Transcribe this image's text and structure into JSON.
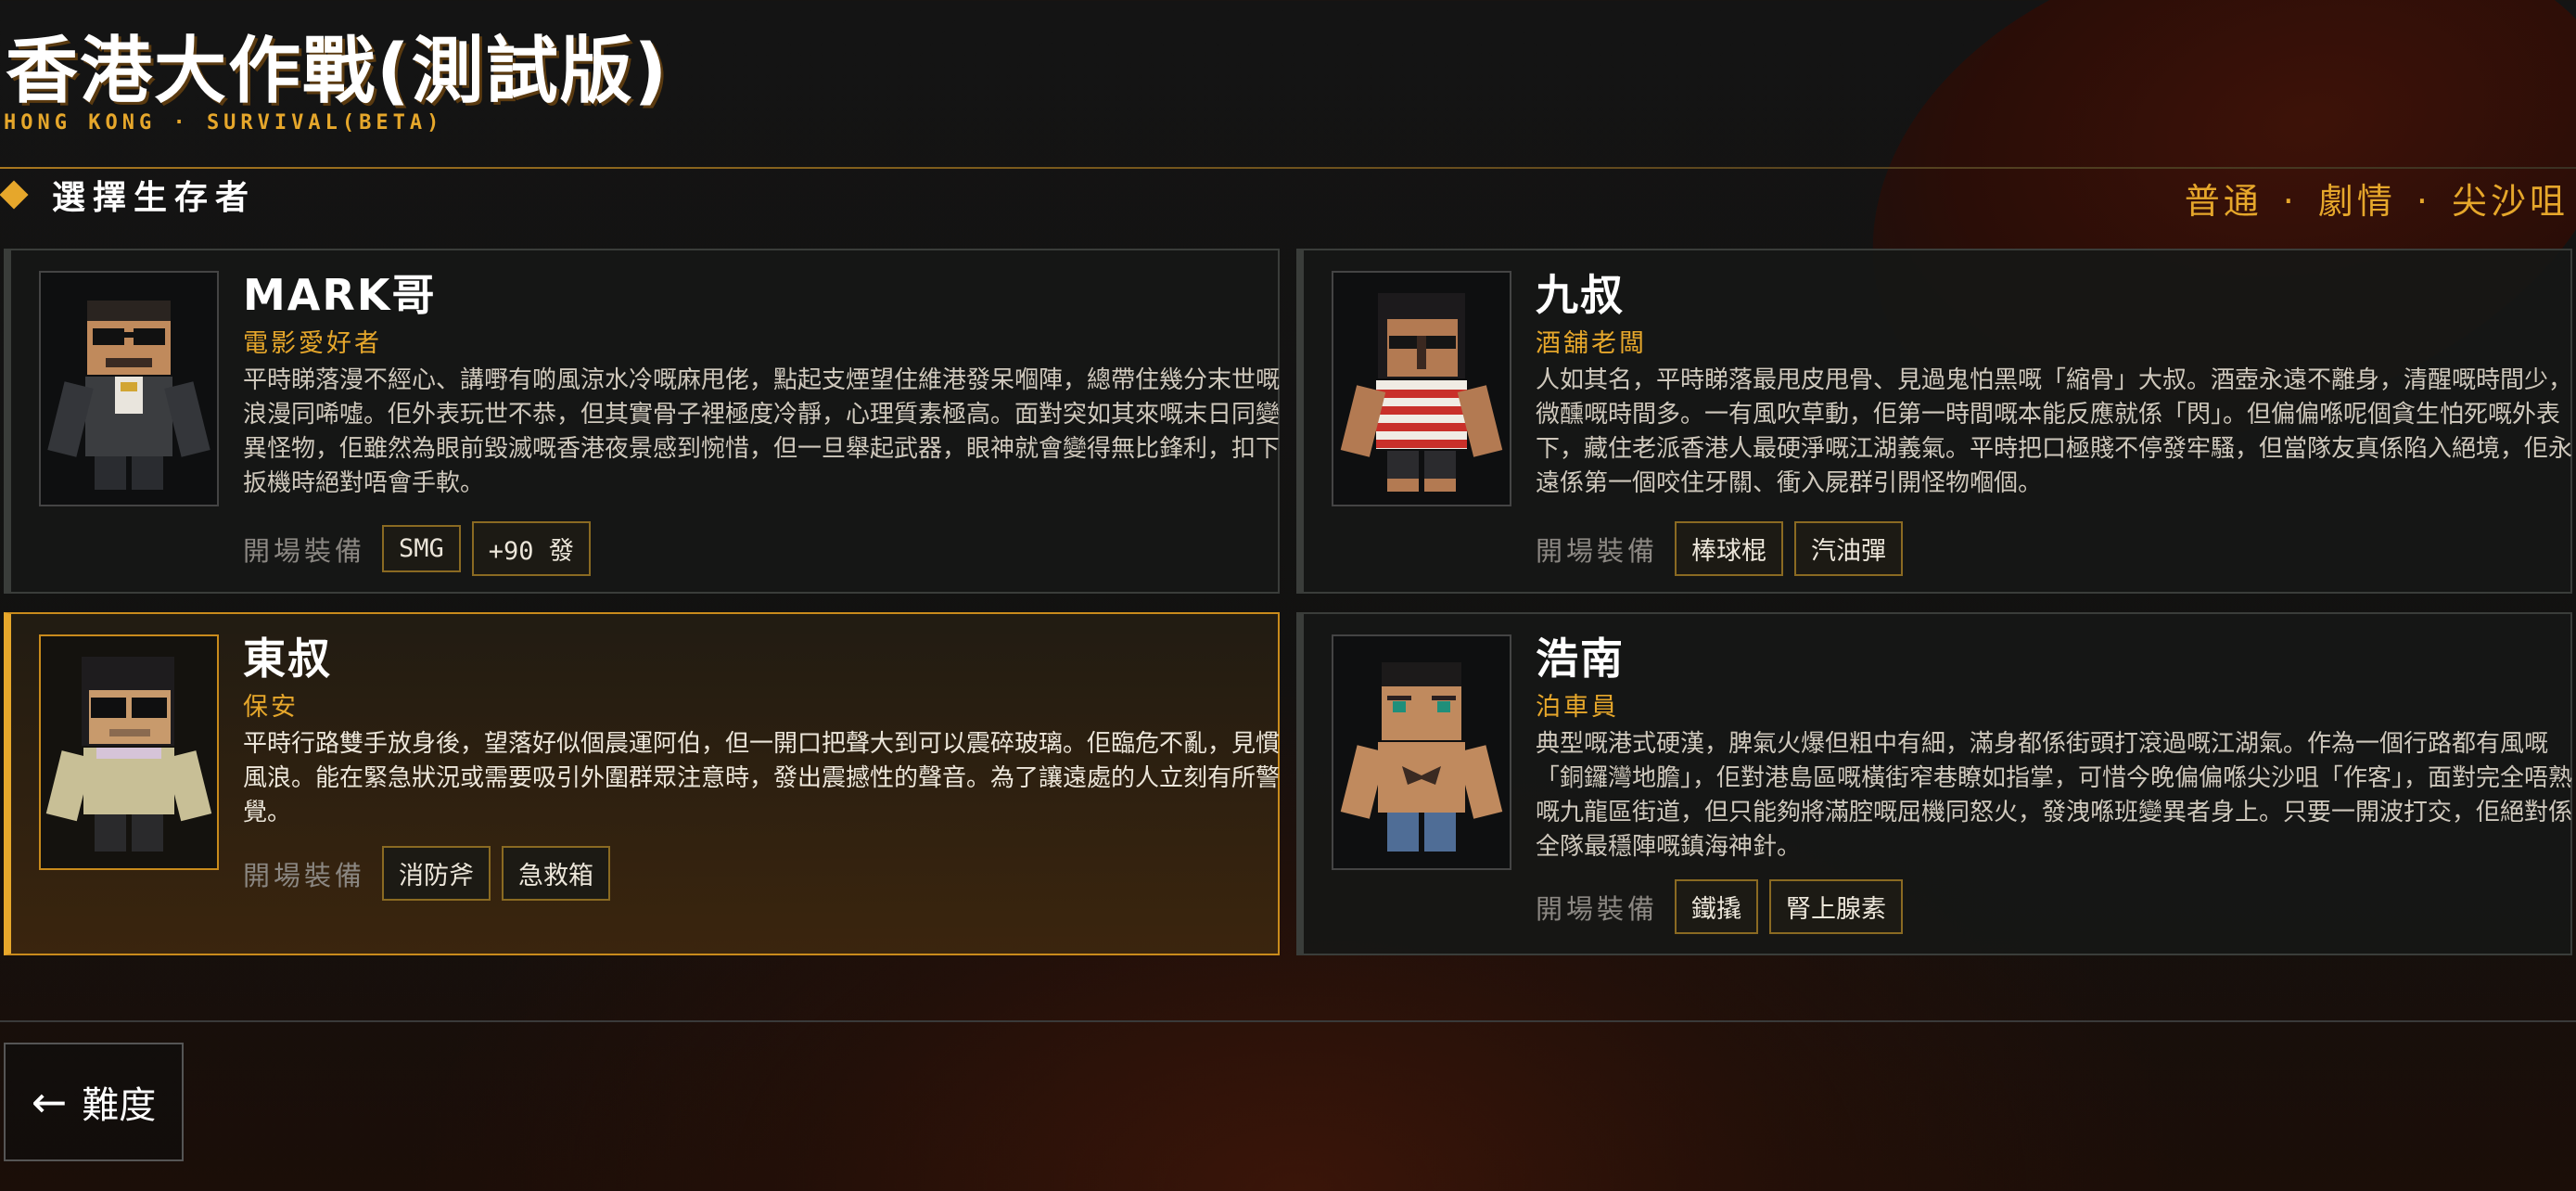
{
  "header": {
    "title": "香港大作戰(測試版)",
    "subtitle": "HONG KONG · SURVIVAL(BETA)",
    "section_label": "選擇生存者",
    "mode": [
      "普通",
      "劇情",
      "尖沙咀"
    ],
    "mode_separator": "·"
  },
  "equip_label": "開場裝備",
  "characters": [
    {
      "name": "MARK哥",
      "role": "電影愛好者",
      "description": "平時睇落漫不經心、講嘢有啲風涼水冷嘅麻甩佬，點起支煙望住維港發呆嗰陣，總帶住幾分末世嘅浪漫同唏噓。佢外表玩世不恭，但其實骨子裡極度冷靜，心理質素極高。面對突如其來嘅末日同變異怪物，佢雖然為眼前毀滅嘅香港夜景感到惋惜，但一旦舉起武器，眼神就會變得無比鋒利，扣下扳機時絕對唔會手軟。",
      "equipment": [
        "SMG",
        "+90 發"
      ],
      "selected": false
    },
    {
      "name": "九叔",
      "role": "酒舖老闆",
      "description": "人如其名，平時睇落最甩皮甩骨、見過鬼怕黑嘅「縮骨」大叔。酒壺永遠不離身，清醒嘅時間少，微醺嘅時間多。一有風吹草動，佢第一時間嘅本能反應就係「閃」。但偏偏喺呢個貪生怕死嘅外表下，藏住老派香港人最硬淨嘅江湖義氣。平時把口極賤不停發牢騷，但當隊友真係陷入絕境，佢永遠係第一個咬住牙關、衝入屍群引開怪物嗰個。",
      "equipment": [
        "棒球棍",
        "汽油彈"
      ],
      "selected": false
    },
    {
      "name": "東叔",
      "role": "保安",
      "description": "平時行路雙手放身後，望落好似個晨運阿伯，但一開口把聲大到可以震碎玻璃。佢臨危不亂，見慣風浪。能在緊急狀況或需要吸引外圍群眾注意時，發出震撼性的聲音。為了讓遠處的人立刻有所警覺。",
      "equipment": [
        "消防斧",
        "急救箱"
      ],
      "selected": true
    },
    {
      "name": "浩南",
      "role": "泊車員",
      "description": "典型嘅港式硬漢，脾氣火爆但粗中有細，滿身都係街頭打滾過嘅江湖氣。作為一個行路都有風嘅「銅鑼灣地膽」，佢對港島區嘅橫街窄巷瞭如指掌，可惜今晚偏偏喺尖沙咀「作客」，面對完全唔熟嘅九龍區街道，但只能夠將滿腔嘅屈機同怒火，發洩喺班變異者身上。只要一開波打交，佢絕對係全隊最穩陣嘅鎮海神針。",
      "equipment": [
        "鐵撬",
        "腎上腺素"
      ],
      "selected": false
    }
  ],
  "back_button": {
    "arrow": "←",
    "label": "難度"
  },
  "colors": {
    "accent": "#e6a72b",
    "selected_border": "#c98b1c",
    "card_bg": "#161716"
  }
}
